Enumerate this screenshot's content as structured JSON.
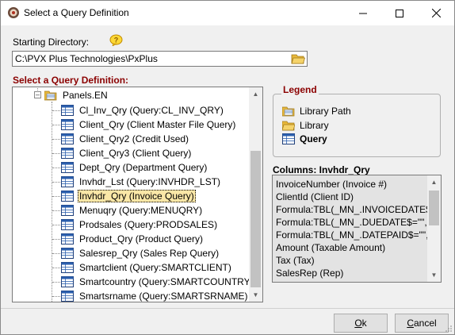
{
  "window": {
    "title": "Select a Query Definition"
  },
  "starting_directory": {
    "label": "Starting Directory:",
    "value": "C:\\PVX Plus Technologies\\PxPlus"
  },
  "tree": {
    "label": "Select a Query Definition:",
    "root": "Panels.EN",
    "items": [
      "Cl_Inv_Qry (Query:CL_INV_QRY)",
      "Client_Qry (Client Master File Query)",
      "Client_Qry2 (Credit Used)",
      "Client_Qry3 (Client Query)",
      "Dept_Qry (Department Query)",
      "Invhdr_Lst (Query:INVHDR_LST)",
      "Invhdr_Qry (Invoice Query)",
      "Menuqry (Query:MENUQRY)",
      "Prodsales (Query:PRODSALES)",
      "Product_Qry (Product Query)",
      "Salesrep_Qry (Sales Rep Query)",
      "Smartclient (Query:SMARTCLIENT)",
      "Smartcountry (Query:SMARTCOUNTRY)",
      "Smartsrname (Query:SMARTSRNAME)"
    ],
    "selected_index": 6
  },
  "legend": {
    "title": "Legend",
    "items": [
      "Library Path",
      "Library",
      "Query"
    ]
  },
  "columns": {
    "label": "Columns:  Invhdr_Qry",
    "items": [
      "InvoiceNumber (Invoice #)",
      "ClientId (Client ID)",
      "Formula:TBL(_MN_.INVOICEDATE$='",
      "Formula:TBL(_MN_.DUEDATE$=\"\",DT",
      "Formula:TBL(_MN_.DATEPAID$=\"\",DT",
      "Amount (Taxable Amount)",
      "Tax (Tax)",
      "SalesRep (Rep)"
    ]
  },
  "buttons": {
    "ok_label": "Ok",
    "ok_mnemonic": "O",
    "ok_rest": "k",
    "cancel_mnemonic": "C",
    "cancel_rest": "ancel",
    "cancel_label": "Cancel"
  },
  "colors": {
    "section_title": "#8b0000",
    "selected_row": "#fbe7a7",
    "scroll_thumb": "#c2c2c2"
  }
}
